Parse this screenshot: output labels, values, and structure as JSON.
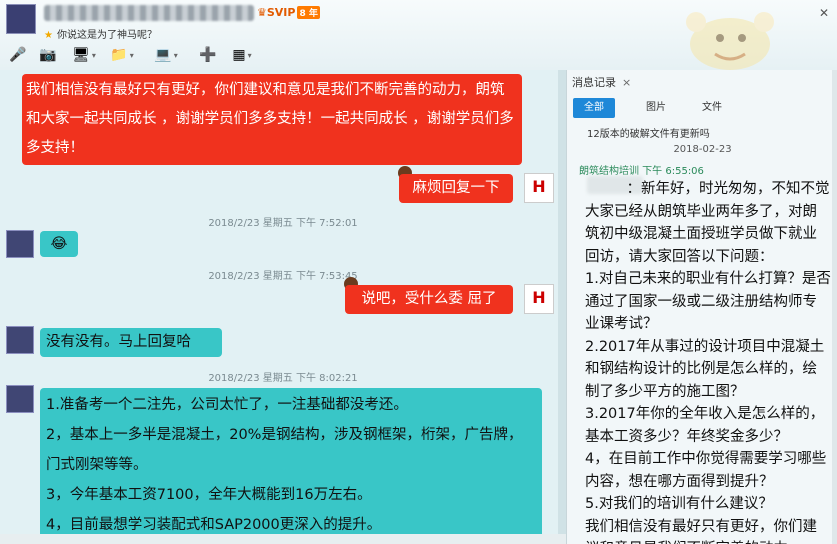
{
  "header": {
    "vip_label": "SVIP",
    "vip_badge": "8 年",
    "signature": "你说这是为了神马呢？"
  },
  "toolbar": {
    "icons": [
      "microphone-icon",
      "video-camera-icon",
      "screen-share-icon",
      "folder-send-icon",
      "remote-desktop-icon",
      "add-app-icon",
      "apps-grid-icon"
    ]
  },
  "chat": {
    "msg1": "我们相信没有最好只有更好，你们建议和意见是我们不断完善的动力，朗筑和大家一起共同成长 ，谢谢学员们多多支持！一起共同成长 ，谢谢学员们多多支持！",
    "msg2": "麻烦回复一下",
    "ts1": "2018/2/23 星期五 下午 7:52:01",
    "msg3": "😂",
    "ts2": "2018/2/23 星期五 下午 7:53:45",
    "msg4": "说吧，受什么委  屈了",
    "msg5": "没有没有。马上回复哈",
    "ts3": "2018/2/23 星期五 下午 8:02:21",
    "msg6_lines": [
      "1.准备考一个二注先，公司太忙了，一注基础都没考还。",
      "2，基本上一多半是混凝土，20%是钢结构，涉及钢框架，桁架，广告牌，门式刚架等等。",
      "3，今年基本工资7100，全年大概能到16万左右。",
      "4，目前最想学习装配式和SAP2000更深入的提升。"
    ],
    "logo_text": "H"
  },
  "side": {
    "tab_label": "消息记录",
    "close_glyph": "×",
    "filters": [
      "全部",
      "图片",
      "文件"
    ],
    "prev_message": "12版本的破解文件有更新吗",
    "date": "2018-02-23",
    "sender": "朗筑结构培训 下午 6:55:06",
    "message": "         ：新年好，时光匆匆，不知不觉大家已经从朗筑毕业两年多了，对朗筑初中级混凝土面授班学员做下就业回访，请大家回答以下问题：\n1.对自己未来的职业有什么打算？是否通过了国家一级或二级注册结构师专业课考试？\n2.2017年从事过的设计项目中混凝土和钢结构设计的比例是怎么样的，绘制了多少平方的施工图？\n3.2017年你的全年收入是怎么样的，基本工资多少？年终奖金多少？\n4，在目前工作中你觉得需要学习哪些内容，想在哪方面得到提升？\n5.对我们的培训有什么建议？\n我们相信没有最好只有更好，你们建议和意见是我们不断完善的动力"
  },
  "colors": {
    "red_bubble": "#f0321e",
    "teal_bubble": "#39c6c7",
    "accent": "#1e88d8"
  }
}
